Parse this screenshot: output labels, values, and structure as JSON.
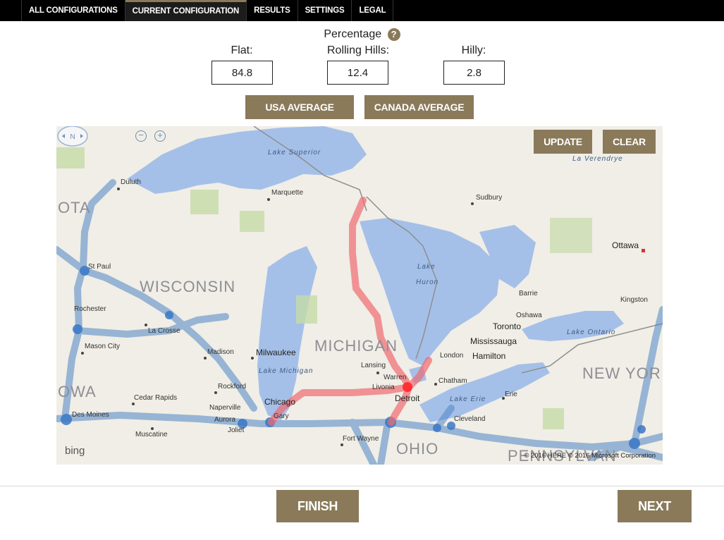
{
  "nav": {
    "tabs": [
      {
        "label": "ALL CONFIGURATIONS"
      },
      {
        "label": "CURRENT CONFIGURATION",
        "active": true
      },
      {
        "label": "RESULTS"
      },
      {
        "label": "SETTINGS"
      },
      {
        "label": "LEGAL"
      }
    ]
  },
  "percentage": {
    "title": "Percentage",
    "help_icon": "?",
    "flat_label": "Flat:",
    "flat_value": "84.8",
    "rolling_label": "Rolling Hills:",
    "rolling_value": "12.4",
    "hilly_label": "Hilly:",
    "hilly_value": "2.8"
  },
  "buttons": {
    "usa_average": "USA AVERAGE",
    "canada_average": "CANADA AVERAGE",
    "update": "UPDATE",
    "clear": "CLEAR",
    "finish": "FINISH",
    "next": "NEXT"
  },
  "map": {
    "compass_label": "N",
    "zoom_out": "−",
    "zoom_in": "+",
    "bing_label": "bing",
    "copyright": "© 2016 HERE    © 2016 Microsoft Corporation",
    "water_labels": {
      "lake_superior": "Lake Superior",
      "lake_michigan": "Lake Michigan",
      "lake_huron_1": "Lake",
      "lake_huron_2": "Huron",
      "lake_erie": "Lake Erie",
      "lake_ontario": "Lake Ontario",
      "la_verendrye": "La Verendrye"
    },
    "state_labels": {
      "wisconsin": "WISCONSIN",
      "michigan": "MICHIGAN",
      "ohio": "OHIO",
      "new_york": "NEW YOR",
      "pennsylvania": "PENNSYLVAN",
      "iowa": "OWA",
      "minnesota": "OTA"
    },
    "cities": {
      "duluth": "Duluth",
      "marquette": "Marquette",
      "sudbury": "Sudbury",
      "ottawa": "Ottawa",
      "st_paul": "St Paul",
      "rochester": "Rochester",
      "la_crosse": "La Crosse",
      "mason_city": "Mason City",
      "madison": "Madison",
      "milwaukee": "Milwaukee",
      "rockford": "Rockford",
      "cedar_rapids": "Cedar Rapids",
      "naperville": "Naperville",
      "aurora": "Aurora",
      "joliet": "Joliet",
      "chicago": "Chicago",
      "gary": "Gary",
      "des_moines": "Des Moines",
      "muscatine": "Muscatine",
      "fort_wayne": "Fort Wayne",
      "lansing": "Lansing",
      "warren": "Warren",
      "livonia": "Livonia",
      "detroit": "Detroit",
      "chatham": "Chatham",
      "london": "London",
      "hamilton": "Hamilton",
      "mississauga": "Mississauga",
      "toronto": "Toronto",
      "oshawa": "Oshawa",
      "barrie": "Barrie",
      "kingston": "Kingston",
      "erie": "Erie",
      "cleveland": "Cleveland"
    }
  },
  "colors": {
    "accent": "#8a7a5a",
    "route_red": "#f06b72",
    "route_blue": "#4f86c6",
    "water": "#a5c0e8",
    "land": "#f0eee6",
    "nav_bg": "#000000"
  }
}
